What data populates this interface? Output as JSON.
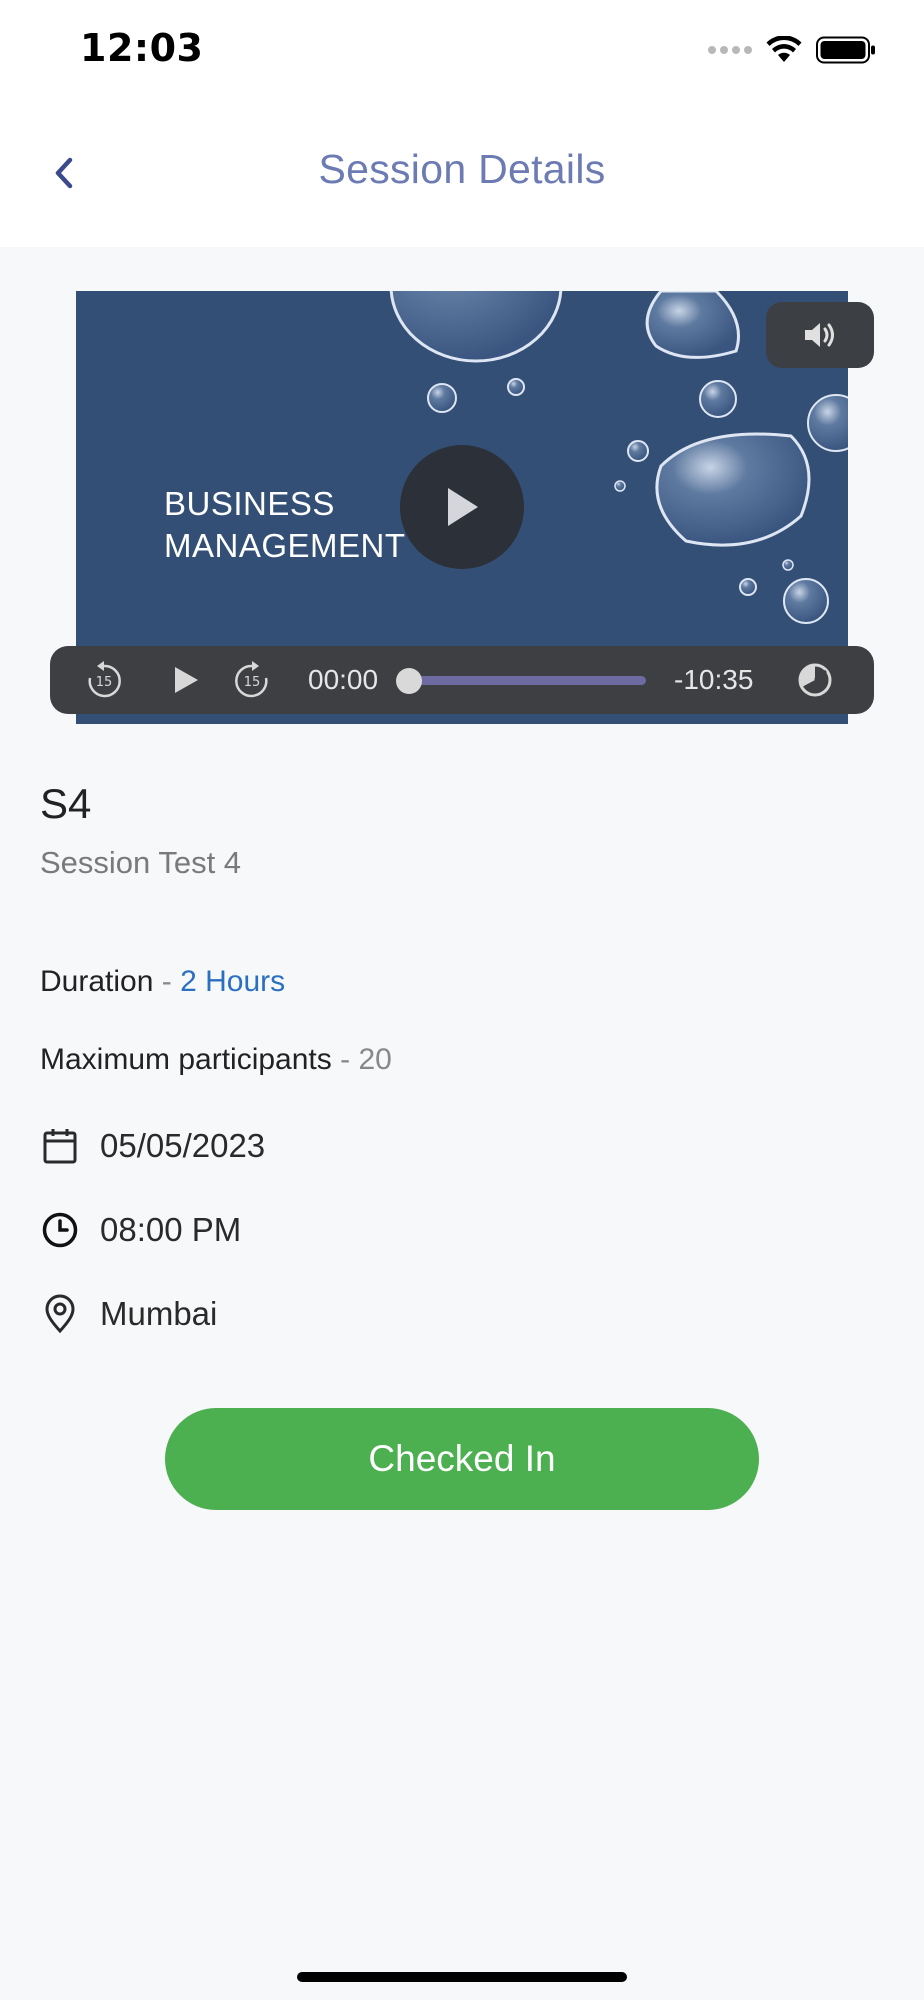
{
  "status_bar": {
    "time": "12:03"
  },
  "nav": {
    "title": "Session Details",
    "back_icon": "chevron-left-icon"
  },
  "video": {
    "caption_line1": "BUSINESS",
    "caption_line2": "MANAGEMENT",
    "elapsed": "00:00",
    "remaining": "-10:35",
    "progress": 0.0
  },
  "session": {
    "code": "S4",
    "name": "Session Test 4",
    "duration_label": "Duration",
    "separator": " - ",
    "duration_value": "2 Hours",
    "participants_label": "Maximum participants",
    "participants_value": "20",
    "date": "05/05/2023",
    "time": "08:00 PM",
    "location": "Mumbai"
  },
  "actions": {
    "checkin_label": "Checked In"
  },
  "colors": {
    "accent": "#6c7bb3",
    "link": "#2a6fc0",
    "success": "#4caf50",
    "video_bg": "#344f76"
  }
}
